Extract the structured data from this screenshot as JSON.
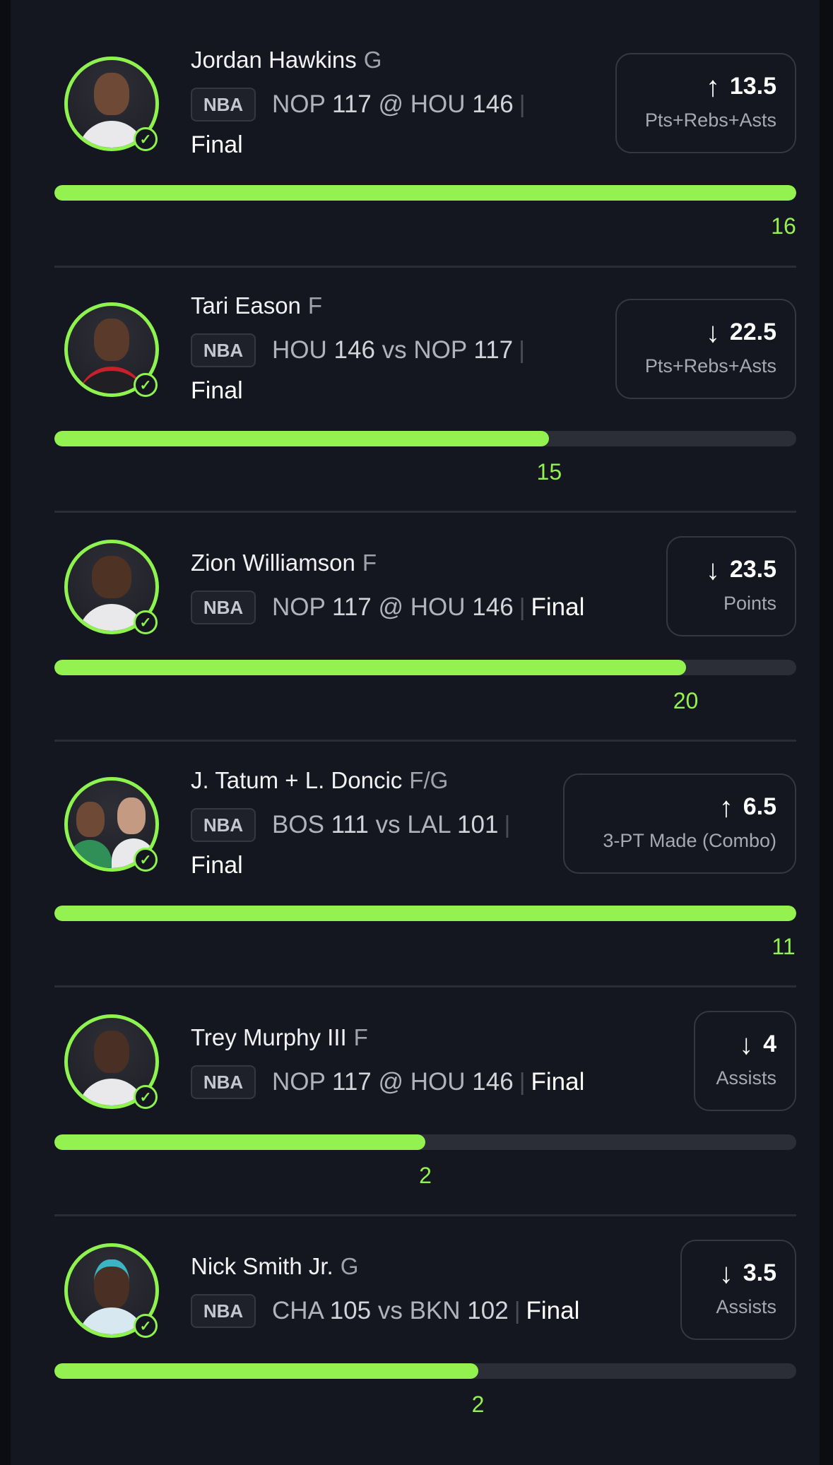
{
  "cards": [
    {
      "name": "Jordan Hawkins",
      "position": "G",
      "league": "NBA",
      "game": {
        "team1": "NOP",
        "score1": "117",
        "sep": "@",
        "team2": "HOU",
        "score2": "146"
      },
      "status": "Final",
      "direction_icon": "arrow-up-icon",
      "arrow": "↑",
      "line": "13.5",
      "stat": "Pts+Rebs+Asts",
      "result": "16",
      "progress": 1.0
    },
    {
      "name": "Tari Eason",
      "position": "F",
      "league": "NBA",
      "game": {
        "team1": "HOU",
        "score1": "146",
        "sep": "vs",
        "team2": "NOP",
        "score2": "117"
      },
      "status": "Final",
      "direction_icon": "arrow-down-icon",
      "arrow": "↓",
      "line": "22.5",
      "stat": "Pts+Rebs+Asts",
      "result": "15",
      "progress": 0.667
    },
    {
      "name": "Zion Williamson",
      "position": "F",
      "league": "NBA",
      "game": {
        "team1": "NOP",
        "score1": "117",
        "sep": "@",
        "team2": "HOU",
        "score2": "146"
      },
      "status": "Final",
      "direction_icon": "arrow-down-icon",
      "arrow": "↓",
      "line": "23.5",
      "stat": "Points",
      "result": "20",
      "progress": 0.851
    },
    {
      "name": "J. Tatum + L. Doncic",
      "position": "F/G",
      "league": "NBA",
      "game": {
        "team1": "BOS",
        "score1": "111",
        "sep": "vs",
        "team2": "LAL",
        "score2": "101"
      },
      "status": "Final",
      "direction_icon": "arrow-up-icon",
      "arrow": "↑",
      "line": "6.5",
      "stat": "3-PT Made (Combo)",
      "result": "11",
      "progress": 1.0
    },
    {
      "name": "Trey Murphy III",
      "position": "F",
      "league": "NBA",
      "game": {
        "team1": "NOP",
        "score1": "117",
        "sep": "@",
        "team2": "HOU",
        "score2": "146"
      },
      "status": "Final",
      "direction_icon": "arrow-down-icon",
      "arrow": "↓",
      "line": "4",
      "stat": "Assists",
      "result": "2",
      "progress": 0.5
    },
    {
      "name": "Nick Smith Jr.",
      "position": "G",
      "league": "NBA",
      "game": {
        "team1": "CHA",
        "score1": "105",
        "sep": "vs",
        "team2": "BKN",
        "score2": "102"
      },
      "status": "Final",
      "direction_icon": "arrow-down-icon",
      "arrow": "↓",
      "line": "3.5",
      "stat": "Assists",
      "result": "2",
      "progress": 0.571
    }
  ],
  "colors": {
    "accent": "#93f150",
    "background": "#141620",
    "track": "#2b2d37"
  }
}
